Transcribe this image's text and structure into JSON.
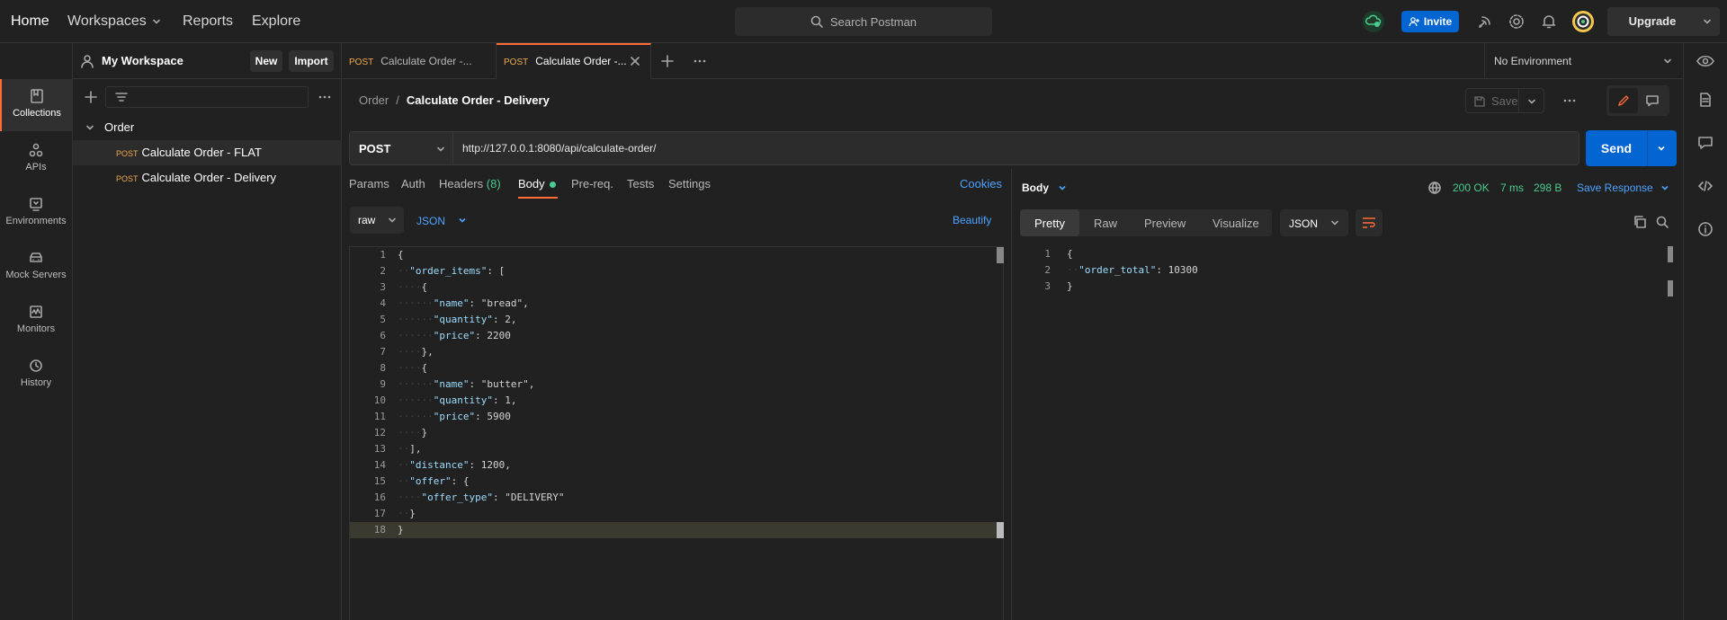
{
  "nav": {
    "home": "Home",
    "workspaces": "Workspaces",
    "reports": "Reports",
    "explore": "Explore",
    "search_placeholder": "Search Postman",
    "invite": "Invite",
    "upgrade": "Upgrade"
  },
  "workspace": {
    "name": "My Workspace",
    "new_label": "New",
    "import_label": "Import"
  },
  "rail": {
    "items": [
      {
        "label": "Collections",
        "icon": "collections-icon"
      },
      {
        "label": "APIs",
        "icon": "apis-icon"
      },
      {
        "label": "Environments",
        "icon": "environments-icon"
      },
      {
        "label": "Mock Servers",
        "icon": "mock-servers-icon"
      },
      {
        "label": "Monitors",
        "icon": "monitors-icon"
      },
      {
        "label": "History",
        "icon": "history-icon"
      }
    ]
  },
  "collection": {
    "folder": "Order",
    "requests": [
      {
        "method": "POST",
        "name": "Calculate Order - FLAT"
      },
      {
        "method": "POST",
        "name": "Calculate Order - Delivery"
      }
    ]
  },
  "tabs": [
    {
      "method": "POST",
      "title": "Calculate Order -..."
    },
    {
      "method": "POST",
      "title": "Calculate Order -..."
    }
  ],
  "environment": "No Environment",
  "request": {
    "breadcrumb_parent": "Order",
    "breadcrumb_separator": "/",
    "title": "Calculate Order - Delivery",
    "save_label": "Save",
    "method": "POST",
    "url": "http://127.0.0.1:8080/api/calculate-order/",
    "send_label": "Send",
    "subtabs": {
      "params": "Params",
      "auth": "Auth",
      "headers": "Headers",
      "headers_count": "(8)",
      "body": "Body",
      "prereq": "Pre-req.",
      "tests": "Tests",
      "settings": "Settings"
    },
    "cookies": "Cookies",
    "body_mode": "raw",
    "body_lang": "JSON",
    "beautify": "Beautify"
  },
  "request_body_lines": [
    "{",
    "  \"order_items\": [",
    "    {",
    "      \"name\": \"bread\",",
    "      \"quantity\": 2,",
    "      \"price\": 2200",
    "    },",
    "    {",
    "      \"name\": \"butter\",",
    "      \"quantity\": 1,",
    "      \"price\": 5900",
    "    }",
    "  ],",
    "  \"distance\": 1200,",
    "  \"offer\": {",
    "    \"offer_type\": \"DELIVERY\"",
    "  }",
    "}"
  ],
  "response": {
    "section_label": "Body",
    "status": "200 OK",
    "time": "7 ms",
    "size": "298 B",
    "save_response": "Save Response",
    "view_tabs": [
      "Pretty",
      "Raw",
      "Preview",
      "Visualize"
    ],
    "format": "JSON",
    "body_lines": [
      "{",
      "  \"order_total\": 10300",
      "}"
    ]
  },
  "colors": {
    "accent": "#ff6c37",
    "primary_button": "#0265d2",
    "status_ok": "#49cc90",
    "method_post": "#f0a94d"
  }
}
